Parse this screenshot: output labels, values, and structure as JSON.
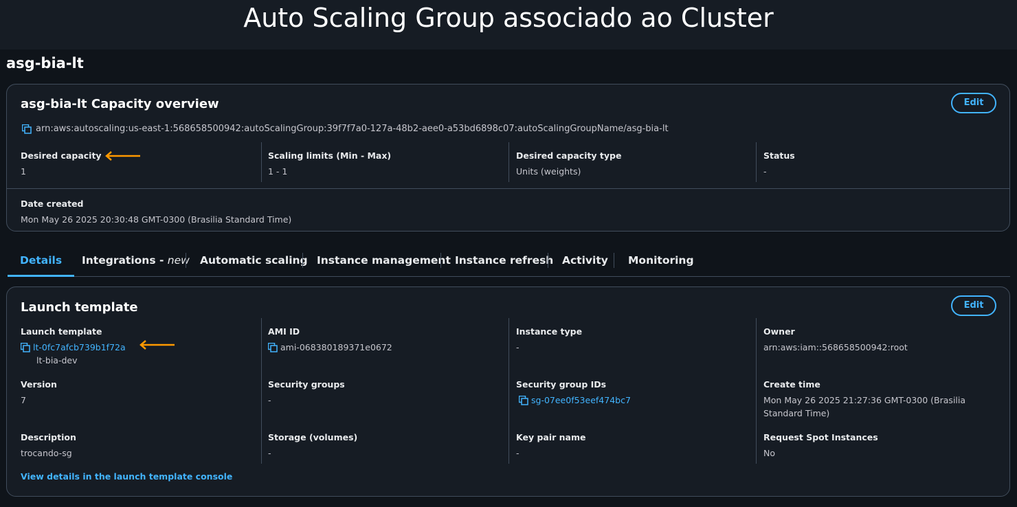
{
  "banner": {
    "title": "Auto Scaling Group associado ao Cluster"
  },
  "page": {
    "title": "asg-bia-lt"
  },
  "capacity": {
    "title": "asg-bia-lt Capacity overview",
    "edit_label": "Edit",
    "arn": "arn:aws:autoscaling:us-east-1:568658500942:autoScalingGroup:39f7f7a0-127a-48b2-aee0-a53bd6898c07:autoScalingGroupName/asg-bia-lt",
    "fields": [
      {
        "label": "Desired capacity",
        "value": "1"
      },
      {
        "label": "Scaling limits (Min - Max)",
        "value": "1 - 1"
      },
      {
        "label": "Desired capacity type",
        "value": "Units (weights)"
      },
      {
        "label": "Status",
        "value": "-"
      }
    ],
    "date_created": {
      "label": "Date created",
      "value": "Mon May 26 2025 20:30:48 GMT-0300 (Brasilia Standard Time)"
    }
  },
  "tabs": [
    {
      "label": "Details"
    },
    {
      "label": "Integrations - ",
      "suffix": "new"
    },
    {
      "label": "Automatic scaling"
    },
    {
      "label": "Instance management"
    },
    {
      "label": "Instance refresh"
    },
    {
      "label": "Activity"
    },
    {
      "label": "Monitoring"
    }
  ],
  "launch_template": {
    "title": "Launch template",
    "edit_label": "Edit",
    "template": {
      "label": "Launch template",
      "id": "lt-0fc7afcb739b1f72a",
      "name": "lt-bia-dev"
    },
    "ami": {
      "label": "AMI ID",
      "value": "ami-068380189371e0672"
    },
    "instance_type": {
      "label": "Instance type",
      "value": "-"
    },
    "owner": {
      "label": "Owner",
      "value": "arn:aws:iam::568658500942:root"
    },
    "version": {
      "label": "Version",
      "value": "7"
    },
    "security_groups": {
      "label": "Security groups",
      "value": "-"
    },
    "security_group_ids": {
      "label": "Security group IDs",
      "value": "sg-07ee0f53eef474bc7"
    },
    "create_time": {
      "label": "Create time",
      "value": "Mon May 26 2025 21:27:36 GMT-0300 (Brasilia Standard Time)"
    },
    "description": {
      "label": "Description",
      "value": "trocando-sg"
    },
    "storage": {
      "label": "Storage (volumes)",
      "value": "-"
    },
    "key_pair": {
      "label": "Key pair name",
      "value": "-"
    },
    "spot": {
      "label": "Request Spot Instances",
      "value": "No"
    },
    "footer_link": "View details in the launch template console"
  },
  "colors": {
    "accent": "#42b4ff",
    "arrow": "#ff9900",
    "background": "#0f141a",
    "card": "#161c24"
  },
  "icons": {
    "copy": "copy-icon",
    "arrow": "arrow-left-icon"
  }
}
